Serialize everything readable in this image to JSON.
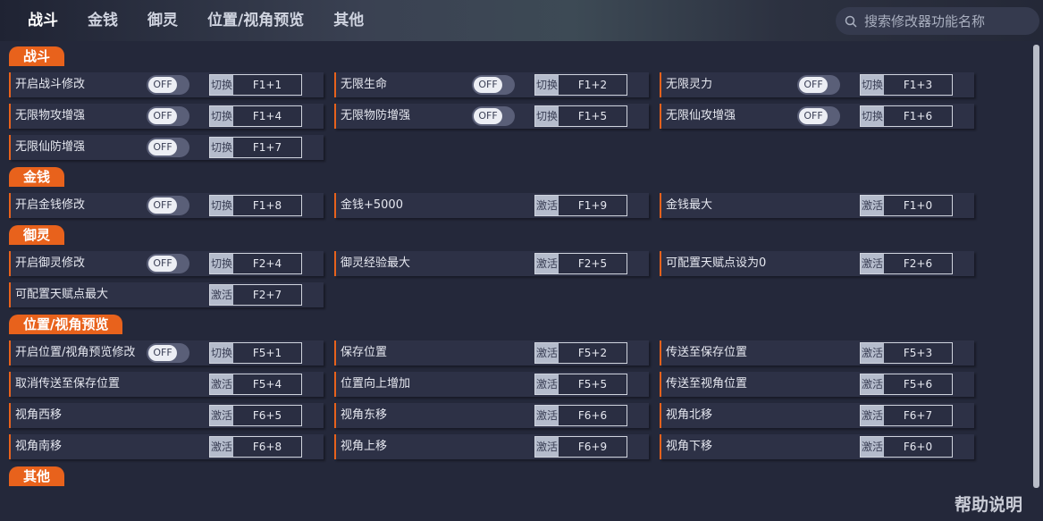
{
  "tabs": [
    "战斗",
    "金钱",
    "御灵",
    "位置/视角预览",
    "其他"
  ],
  "search": {
    "placeholder": "搜索修改器功能名称"
  },
  "help_label": "帮助说明",
  "toggle_off": "OFF",
  "sections": [
    {
      "title": "战斗",
      "rows": [
        [
          {
            "label": "开启战斗修改",
            "toggle": true,
            "type": "切换",
            "key": "F1+1"
          },
          {
            "label": "无限生命",
            "toggle": true,
            "type": "切换",
            "key": "F1+2"
          },
          {
            "label": "无限灵力",
            "toggle": true,
            "type": "切换",
            "key": "F1+3"
          }
        ],
        [
          {
            "label": "无限物攻增强",
            "toggle": true,
            "type": "切换",
            "key": "F1+4"
          },
          {
            "label": "无限物防增强",
            "toggle": true,
            "type": "切换",
            "key": "F1+5"
          },
          {
            "label": "无限仙攻增强",
            "toggle": true,
            "type": "切换",
            "key": "F1+6"
          }
        ],
        [
          {
            "label": "无限仙防增强",
            "toggle": true,
            "type": "切换",
            "key": "F1+7"
          }
        ]
      ]
    },
    {
      "title": "金钱",
      "rows": [
        [
          {
            "label": "开启金钱修改",
            "toggle": true,
            "type": "切换",
            "key": "F1+8"
          },
          {
            "label": "金钱+5000",
            "toggle": false,
            "type": "激活",
            "key": "F1+9"
          },
          {
            "label": "金钱最大",
            "toggle": false,
            "type": "激活",
            "key": "F1+0"
          }
        ]
      ]
    },
    {
      "title": "御灵",
      "rows": [
        [
          {
            "label": "开启御灵修改",
            "toggle": true,
            "type": "切换",
            "key": "F2+4"
          },
          {
            "label": "御灵经验最大",
            "toggle": false,
            "type": "激活",
            "key": "F2+5"
          },
          {
            "label": "可配置天赋点设为0",
            "toggle": false,
            "type": "激活",
            "key": "F2+6"
          }
        ],
        [
          {
            "label": "可配置天赋点最大",
            "toggle": false,
            "type": "激活",
            "key": "F2+7"
          }
        ]
      ]
    },
    {
      "title": "位置/视角预览",
      "rows": [
        [
          {
            "label": "开启位置/视角预览修改",
            "toggle": true,
            "type": "切换",
            "key": "F5+1"
          },
          {
            "label": "保存位置",
            "toggle": false,
            "type": "激活",
            "key": "F5+2"
          },
          {
            "label": "传送至保存位置",
            "toggle": false,
            "type": "激活",
            "key": "F5+3"
          }
        ],
        [
          {
            "label": "取消传送至保存位置",
            "toggle": false,
            "type": "激活",
            "key": "F5+4"
          },
          {
            "label": "位置向上增加",
            "toggle": false,
            "type": "激活",
            "key": "F5+5"
          },
          {
            "label": "传送至视角位置",
            "toggle": false,
            "type": "激活",
            "key": "F5+6"
          }
        ],
        [
          {
            "label": "视角西移",
            "toggle": false,
            "type": "激活",
            "key": "F6+5"
          },
          {
            "label": "视角东移",
            "toggle": false,
            "type": "激活",
            "key": "F6+6"
          },
          {
            "label": "视角北移",
            "toggle": false,
            "type": "激活",
            "key": "F6+7"
          }
        ],
        [
          {
            "label": "视角南移",
            "toggle": false,
            "type": "激活",
            "key": "F6+8"
          },
          {
            "label": "视角上移",
            "toggle": false,
            "type": "激活",
            "key": "F6+9"
          },
          {
            "label": "视角下移",
            "toggle": false,
            "type": "激活",
            "key": "F6+0"
          }
        ]
      ]
    },
    {
      "title": "其他",
      "rows": []
    }
  ]
}
